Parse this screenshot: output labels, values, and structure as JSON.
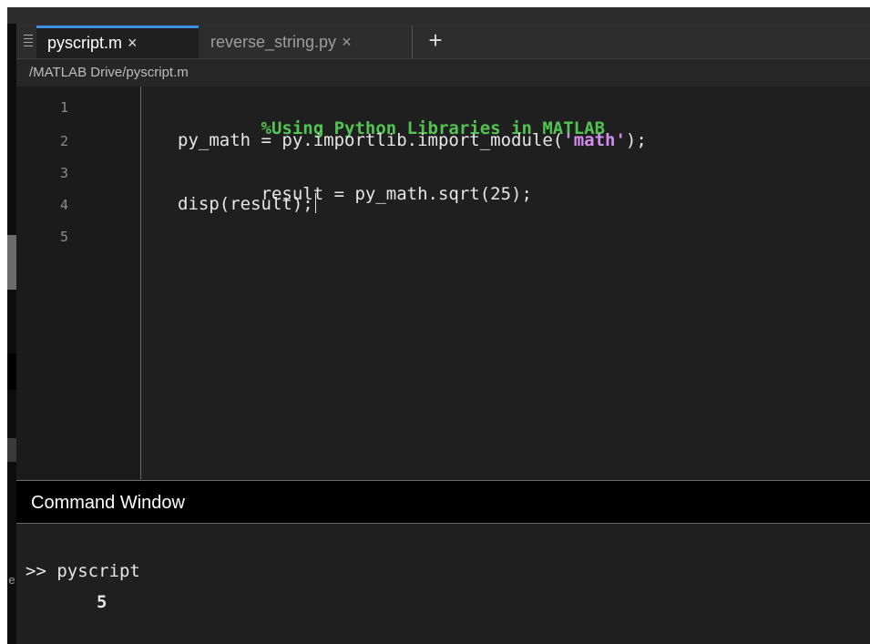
{
  "editor": {
    "tabs": [
      {
        "label": "pyscript.m",
        "close": "×",
        "active": true
      },
      {
        "label": "reverse_string.py",
        "close": "×",
        "active": false
      }
    ],
    "add_tab_glyph": "+",
    "breadcrumb": "/MATLAB Drive/pyscript.m",
    "line_numbers": [
      "1",
      "2",
      "3",
      "4",
      "5"
    ],
    "code": {
      "line1_comment": "%Using Python Libraries in MATLAB",
      "line2_prefix": "py_math = py.importlib.import_module(",
      "line2_string": "'math'",
      "line2_suffix": ");",
      "line3": "result = py_math.sqrt(25);",
      "line4": "disp(result);"
    }
  },
  "command_window": {
    "title": "Command Window",
    "prompt_line": ">> pyscript",
    "output": "5"
  },
  "side_glyph": "e",
  "colors": {
    "accent_tab": "#3d8ee0",
    "comment": "#52c452",
    "string": "#d38cf0",
    "background": "#1f1f1f"
  }
}
